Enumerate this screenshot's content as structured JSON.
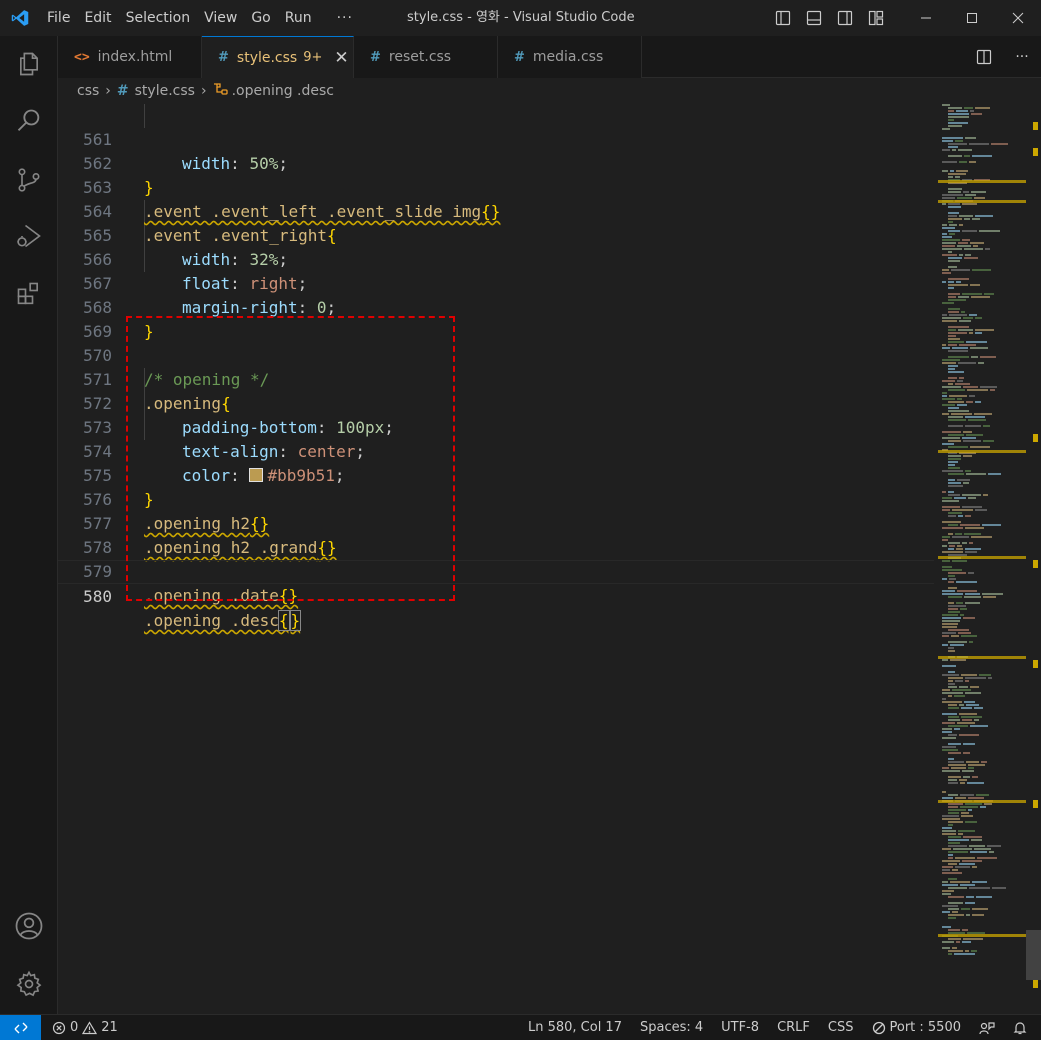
{
  "window": {
    "title": "style.css - 영화 - Visual Studio Code"
  },
  "menu": [
    "File",
    "Edit",
    "Selection",
    "View",
    "Go",
    "Run",
    "···"
  ],
  "tabs": [
    {
      "label": "index.html",
      "icon": "html-icon"
    },
    {
      "label": "style.css",
      "icon": "css-hash-icon",
      "badge": "9+",
      "active": true
    },
    {
      "label": "reset.css",
      "icon": "css-hash-icon"
    },
    {
      "label": "media.css",
      "icon": "css-hash-icon"
    }
  ],
  "breadcrumbs": {
    "folder": "css",
    "file": "style.css",
    "symbol": ".opening .desc"
  },
  "editor": {
    "lines": [
      {
        "n": "561"
      },
      {
        "n": "562"
      },
      {
        "n": "563"
      },
      {
        "n": "564"
      },
      {
        "n": "565"
      },
      {
        "n": "566"
      },
      {
        "n": "567"
      },
      {
        "n": "568"
      },
      {
        "n": "569"
      },
      {
        "n": "570"
      },
      {
        "n": "571"
      },
      {
        "n": "572"
      },
      {
        "n": "573"
      },
      {
        "n": "574"
      },
      {
        "n": "575"
      },
      {
        "n": "576"
      },
      {
        "n": "577"
      },
      {
        "n": "578"
      },
      {
        "n": "579"
      },
      {
        "n": "580"
      }
    ],
    "tokens": {
      "l561_prop": "width",
      "l561_val": "50%",
      "l563_sel": ".event .event_left .event_slide img",
      "l564_sel": ".event .event_right",
      "l565_prop": "width",
      "l565_val": "32%",
      "l566_prop": "float",
      "l566_val": "right",
      "l567_prop": "margin-right",
      "l567_val": "0",
      "l570_cmt": "/* opening */",
      "l571_sel": ".opening",
      "l572_prop": "padding-bottom",
      "l572_val": "100px",
      "l573_prop": "text-align",
      "l573_val": "center",
      "l574_prop": "color",
      "l574_val": "#bb9b51",
      "l576_sel": ".opening h2",
      "l577_sel": ".opening h2 .grand",
      "l579_sel": ".opening .date",
      "l580_sel": ".opening .desc"
    },
    "swatch_color": "#bb9b51",
    "current_line": "580"
  },
  "statusbar": {
    "errors": "0",
    "warnings": "21",
    "position": "Ln 580, Col 17",
    "spaces": "Spaces: 4",
    "encoding": "UTF-8",
    "eol": "CRLF",
    "language": "CSS",
    "port": "Port : 5500"
  },
  "colors": {
    "accent": "#0078d4",
    "annotation": "#e00000",
    "warning": "#cca700"
  }
}
